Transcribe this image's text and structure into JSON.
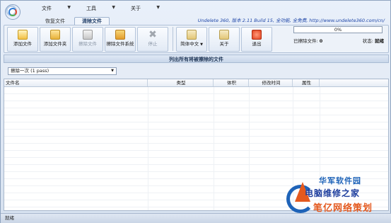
{
  "menu": [
    {
      "label": "文件"
    },
    {
      "label": "工具"
    },
    {
      "label": "关于"
    }
  ],
  "tabs": [
    {
      "label": "恢复文件",
      "active": false
    },
    {
      "label": "清除文件",
      "active": true
    }
  ],
  "banner": "Undelete 360, 版本 2.11 Build 15, 全功能, 全免费, http://www.undelete360.com/cn/",
  "toolbar": {
    "add_file": "添加文件",
    "add_folder": "添加文件夹",
    "erase_file": "擦除文件",
    "erase_system": "擦除文件系统",
    "stop": "停止",
    "language": "简体中文",
    "about": "关于",
    "exit": "退出"
  },
  "progress": {
    "percent_text": "0%",
    "value": 0
  },
  "erased_label": "已擦除文件:",
  "erased_count": "0",
  "state_label": "状态:",
  "state_value": "就绪",
  "section_title": "列出所有将被擦除的文件",
  "erase_method": "擦除一次 (1 pass)",
  "columns": [
    "文件名",
    "类型",
    "体积",
    "修改时间",
    "属性"
  ],
  "status_bar": "就绪",
  "watermark": {
    "line1": "华军软件园",
    "line2": "电脑维修之家",
    "line3": "笔亿网络策划"
  },
  "colors": {
    "accent": "#1f46a8",
    "progress_fill": "#5aa35a",
    "watermark_orange": "#e4591e"
  }
}
